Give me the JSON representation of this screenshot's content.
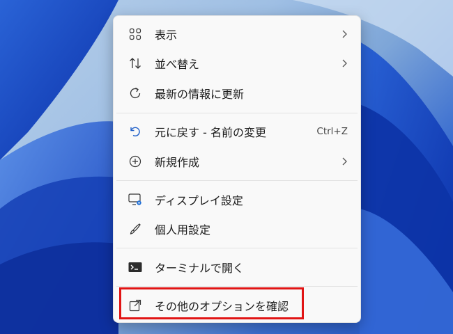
{
  "desktop": {
    "wallpaper": "windows-11-bloom",
    "accent": "#1e4fc2"
  },
  "context_menu": {
    "items": [
      {
        "label": "表示",
        "icon": "grid-icon",
        "has_submenu": true,
        "shortcut": ""
      },
      {
        "label": "並べ替え",
        "icon": "sort-icon",
        "has_submenu": true,
        "shortcut": ""
      },
      {
        "label": "最新の情報に更新",
        "icon": "refresh-icon",
        "has_submenu": false,
        "shortcut": ""
      },
      {
        "label": "元に戻す - 名前の変更",
        "icon": "undo-icon",
        "has_submenu": false,
        "shortcut": "Ctrl+Z"
      },
      {
        "label": "新規作成",
        "icon": "plus-circle-icon",
        "has_submenu": true,
        "shortcut": ""
      },
      {
        "label": "ディスプレイ設定",
        "icon": "display-settings-icon",
        "has_submenu": false,
        "shortcut": ""
      },
      {
        "label": "個人用設定",
        "icon": "brush-icon",
        "has_submenu": false,
        "shortcut": ""
      },
      {
        "label": "ターミナルで開く",
        "icon": "terminal-icon",
        "has_submenu": false,
        "shortcut": ""
      },
      {
        "label": "その他のオプションを確認",
        "icon": "open-external-icon",
        "has_submenu": false,
        "shortcut": ""
      }
    ]
  },
  "highlight": {
    "target": "その他のオプションを確認",
    "color": "#e11414"
  }
}
